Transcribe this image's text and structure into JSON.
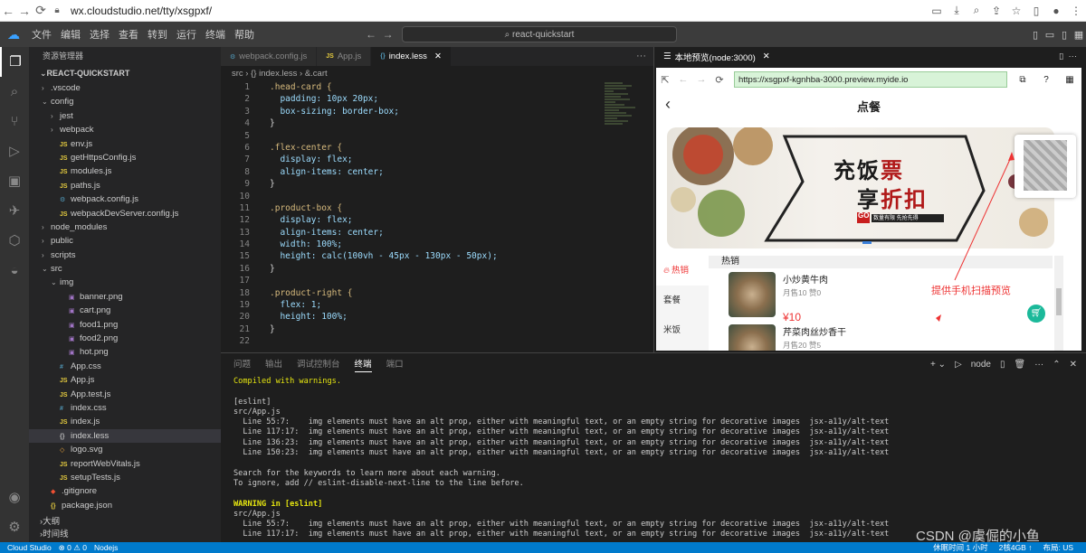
{
  "browser": {
    "url": "wx.cloudstudio.net/tty/xsgpxf/"
  },
  "ide": {
    "menus": [
      "文件",
      "编辑",
      "选择",
      "查看",
      "转到",
      "运行",
      "终端",
      "帮助"
    ],
    "search_label": "react-quickstart"
  },
  "sidebar": {
    "header": "资源管理器",
    "project": "REACT-QUICKSTART",
    "tree": [
      {
        "label": ".vscode",
        "depth": 1,
        "kind": "folder",
        "open": false
      },
      {
        "label": "config",
        "depth": 1,
        "kind": "folder",
        "open": true
      },
      {
        "label": "jest",
        "depth": 2,
        "kind": "folder",
        "open": false
      },
      {
        "label": "webpack",
        "depth": 2,
        "kind": "folder",
        "open": false
      },
      {
        "label": "env.js",
        "depth": 2,
        "kind": "js"
      },
      {
        "label": "getHttpsConfig.js",
        "depth": 2,
        "kind": "js"
      },
      {
        "label": "modules.js",
        "depth": 2,
        "kind": "js"
      },
      {
        "label": "paths.js",
        "depth": 2,
        "kind": "js"
      },
      {
        "label": "webpack.config.js",
        "depth": 2,
        "kind": "config"
      },
      {
        "label": "webpackDevServer.config.js",
        "depth": 2,
        "kind": "js"
      },
      {
        "label": "node_modules",
        "depth": 1,
        "kind": "folder",
        "open": false
      },
      {
        "label": "public",
        "depth": 1,
        "kind": "folder",
        "open": false
      },
      {
        "label": "scripts",
        "depth": 1,
        "kind": "folder",
        "open": false
      },
      {
        "label": "src",
        "depth": 1,
        "kind": "folder",
        "open": true
      },
      {
        "label": "img",
        "depth": 2,
        "kind": "folder",
        "open": true
      },
      {
        "label": "banner.png",
        "depth": 3,
        "kind": "img"
      },
      {
        "label": "cart.png",
        "depth": 3,
        "kind": "img"
      },
      {
        "label": "food1.png",
        "depth": 3,
        "kind": "img"
      },
      {
        "label": "food2.png",
        "depth": 3,
        "kind": "img"
      },
      {
        "label": "hot.png",
        "depth": 3,
        "kind": "img"
      },
      {
        "label": "App.css",
        "depth": 2,
        "kind": "css"
      },
      {
        "label": "App.js",
        "depth": 2,
        "kind": "js"
      },
      {
        "label": "App.test.js",
        "depth": 2,
        "kind": "js"
      },
      {
        "label": "index.css",
        "depth": 2,
        "kind": "css"
      },
      {
        "label": "index.js",
        "depth": 2,
        "kind": "js"
      },
      {
        "label": "index.less",
        "depth": 2,
        "kind": "less",
        "selected": true
      },
      {
        "label": "logo.svg",
        "depth": 2,
        "kind": "svg"
      },
      {
        "label": "reportWebVitals.js",
        "depth": 2,
        "kind": "js"
      },
      {
        "label": "setupTests.js",
        "depth": 2,
        "kind": "js"
      },
      {
        "label": ".gitignore",
        "depth": 1,
        "kind": "git"
      },
      {
        "label": "package.json",
        "depth": 1,
        "kind": "json"
      }
    ],
    "outline": "大纲",
    "timeline": "时间线"
  },
  "editor": {
    "tabs": [
      {
        "label": "webpack.config.js",
        "icon": "⚙",
        "active": false
      },
      {
        "label": "App.js",
        "icon": "JS",
        "active": false
      },
      {
        "label": "index.less",
        "icon": "{}",
        "active": true
      }
    ],
    "breadcrumb": [
      "src",
      "{} index.less",
      "&.cart"
    ],
    "code": [
      {
        "n": "1",
        "t": ".head-card {"
      },
      {
        "n": "2",
        "t": "  padding: 10px 20px;"
      },
      {
        "n": "3",
        "t": "  box-sizing: border-box;"
      },
      {
        "n": "4",
        "t": "}"
      },
      {
        "n": "5",
        "t": ""
      },
      {
        "n": "6",
        "t": ".flex-center {"
      },
      {
        "n": "7",
        "t": "  display: flex;"
      },
      {
        "n": "8",
        "t": "  align-items: center;"
      },
      {
        "n": "9",
        "t": "}"
      },
      {
        "n": "10",
        "t": ""
      },
      {
        "n": "11",
        "t": ".product-box {"
      },
      {
        "n": "12",
        "t": "  display: flex;"
      },
      {
        "n": "13",
        "t": "  align-items: center;"
      },
      {
        "n": "14",
        "t": "  width: 100%;"
      },
      {
        "n": "15",
        "t": "  height: calc(100vh - 45px - 130px - 50px);"
      },
      {
        "n": "16",
        "t": "}"
      },
      {
        "n": "17",
        "t": ""
      },
      {
        "n": "18",
        "t": ".product-right {"
      },
      {
        "n": "19",
        "t": "  flex: 1;"
      },
      {
        "n": "20",
        "t": "  height: 100%;"
      },
      {
        "n": "21",
        "t": "}"
      },
      {
        "n": "22",
        "t": ""
      }
    ]
  },
  "panel": {
    "tabs": [
      "问题",
      "输出",
      "调试控制台",
      "终端",
      "端口"
    ],
    "active_tab": "终端",
    "terminal_label": "node",
    "lines": [
      {
        "t": "Compiled with warnings.",
        "c": "yellow"
      },
      {
        "t": "",
        "c": ""
      },
      {
        "t": "[eslint]",
        "c": ""
      },
      {
        "t": "src/App.js",
        "c": ""
      },
      {
        "t": "  Line 55:7:    img elements must have an alt prop, either with meaningful text, or an empty string for decorative images  jsx-a11y/alt-text",
        "c": "warn"
      },
      {
        "t": "  Line 117:17:  img elements must have an alt prop, either with meaningful text, or an empty string for decorative images  jsx-a11y/alt-text",
        "c": "warn"
      },
      {
        "t": "  Line 136:23:  img elements must have an alt prop, either with meaningful text, or an empty string for decorative images  jsx-a11y/alt-text",
        "c": "warn"
      },
      {
        "t": "  Line 150:23:  img elements must have an alt prop, either with meaningful text, or an empty string for decorative images  jsx-a11y/alt-text",
        "c": "warn"
      },
      {
        "t": "",
        "c": ""
      },
      {
        "t": "Search for the keywords to learn more about each warning.",
        "c": ""
      },
      {
        "t": "To ignore, add // eslint-disable-next-line to the line before.",
        "c": ""
      },
      {
        "t": "",
        "c": ""
      },
      {
        "t": "WARNING in [eslint]",
        "c": "wbold"
      },
      {
        "t": "src/App.js",
        "c": ""
      },
      {
        "t": "  Line 55:7:    img elements must have an alt prop, either with meaningful text, or an empty string for decorative images  jsx-a11y/alt-text",
        "c": "warn"
      },
      {
        "t": "  Line 117:17:  img elements must have an alt prop, either with meaningful text, or an empty string for decorative images  jsx-a11y/alt-text",
        "c": "warn"
      }
    ]
  },
  "preview": {
    "tab_title": "本地预览(node:3000)",
    "url": "https://xsgpxf-kgnhba-3000.preview.myide.io",
    "page_title": "点餐",
    "banner_text_1": "充饭票",
    "banner_text_2": "享折扣",
    "banner_go": "GO",
    "banner_small": "数量有限 先抢先得",
    "categories": [
      {
        "label": "热销",
        "active": true
      },
      {
        "label": "套餐",
        "active": false
      },
      {
        "label": "米饭",
        "active": false
      }
    ],
    "section_title": "热销",
    "products": [
      {
        "name": "小炒黄牛肉",
        "sales": "月售10 赞0",
        "price": "¥10"
      },
      {
        "name": "芹菜肉丝炒香干",
        "sales": "月售20 赞5",
        "price": ""
      }
    ],
    "annotation": "提供手机扫描预览"
  },
  "status": {
    "left": [
      "Cloud Studio",
      "⊗ 0 ⚠ 0",
      "Nodejs"
    ],
    "right": [
      "休眠时间 1 小时",
      "2核4GB ↑",
      "布局: US"
    ]
  },
  "watermark": "CSDN @虞倔的小鱼",
  "colors": {
    "accent": "#007acc",
    "price": "#ee3333",
    "cart": "#1bb99a"
  }
}
